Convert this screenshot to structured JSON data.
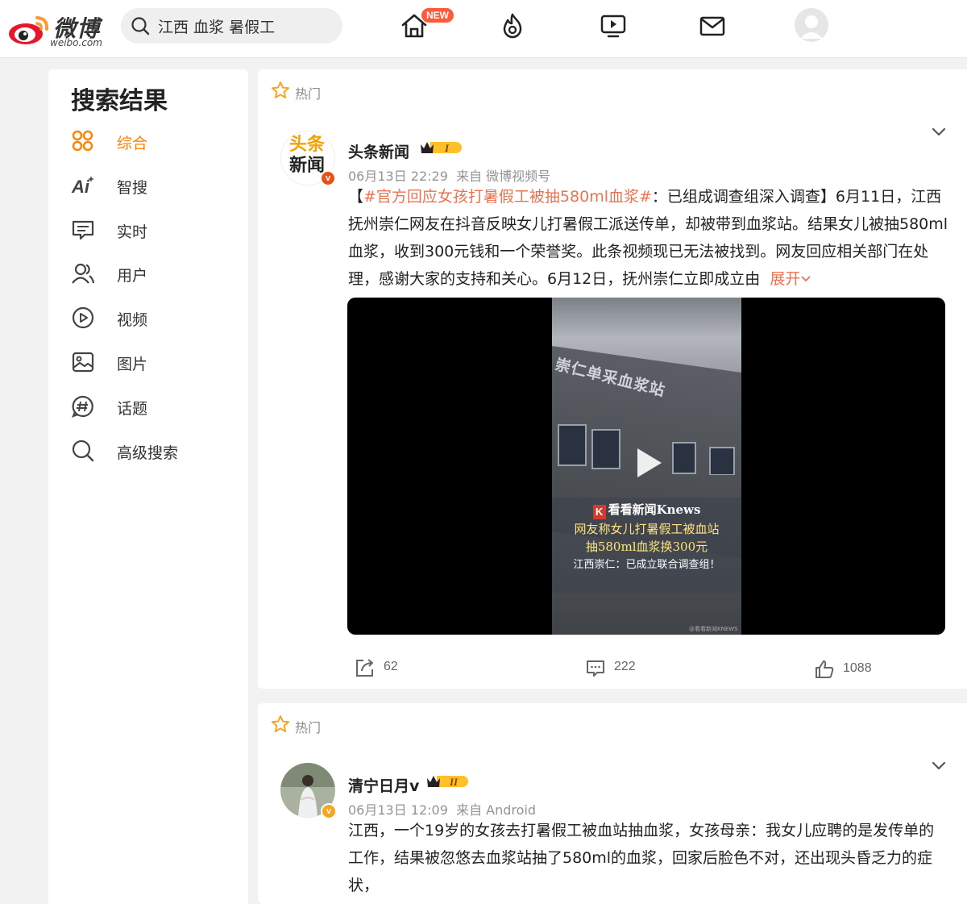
{
  "header": {
    "logo_text": "微博",
    "logo_sub": "weibo.com",
    "search_value": "江西 血浆 暑假工",
    "new_badge": "NEW",
    "brand_color": "#ff8200"
  },
  "sidebar": {
    "title": "搜索结果",
    "items": [
      {
        "label": "综合",
        "icon": "grid-icon",
        "active": true
      },
      {
        "label": "智搜",
        "icon": "ai-icon"
      },
      {
        "label": "实时",
        "icon": "message-icon"
      },
      {
        "label": "用户",
        "icon": "users-icon"
      },
      {
        "label": "视频",
        "icon": "play-circle-icon"
      },
      {
        "label": "图片",
        "icon": "image-icon"
      },
      {
        "label": "话题",
        "icon": "hashtag-icon"
      },
      {
        "label": "高级搜索",
        "icon": "search-icon"
      }
    ]
  },
  "posts": [
    {
      "tag": "热门",
      "author": "头条新闻",
      "avatar_text": [
        "头条",
        "新闻"
      ],
      "badge": "I",
      "time": "06月13日 22:29",
      "source": "来自 微博视频号",
      "hashtag": "#官方回应女孩打暑假工被抽580ml血浆#",
      "text_open": "【",
      "text_body": "：已组成调查组深入调查】6月11日，江西抚州崇仁网友在抖音反映女儿打暑假工派送传单，却被带到血浆站。结果女儿被抽580ml血浆，收到300元钱和一个荣誉奖。此条视频现已无法被找到。网友回应相关部门在处理，感谢大家的支持和关心。6月12日，抚州崇仁立即成立由",
      "expand": "展开",
      "video": {
        "sign": "崇仁单采血浆站",
        "brand": "看看新闻Knews",
        "brand_k": "K",
        "line1": "网友称女儿打暑假工被血站",
        "line2": "抽580ml血浆换300元",
        "line3": "江西崇仁：已成立联合调查组！",
        "watermark": "@看看新闻KNEWS"
      },
      "reposts": "62",
      "comments": "222",
      "likes": "1088"
    },
    {
      "tag": "热门",
      "author": "清宁日月v",
      "badge": "II",
      "time": "06月13日 12:09",
      "source": "来自 Android",
      "text": "江西，一个19岁的女孩去打暑假工被血站抽血浆，女孩母亲：我女儿应聘的是发传单的工作，结果被忽悠去血浆站抽了580ml的血浆，回家后脸色不对，还出现头昏乏力的症状，"
    }
  ]
}
